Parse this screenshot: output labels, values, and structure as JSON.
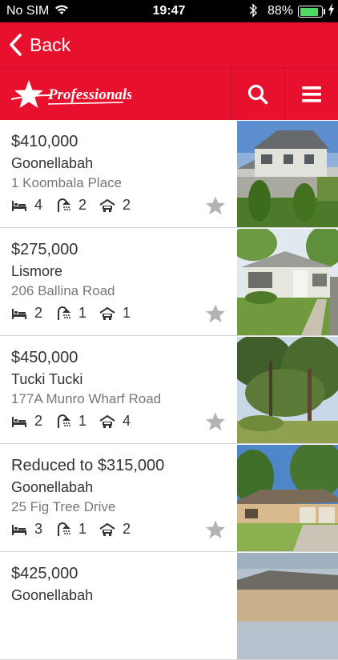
{
  "status_bar": {
    "carrier": "No SIM",
    "time": "19:47",
    "battery_percent": "88%",
    "battery_level": 0.88
  },
  "nav": {
    "back_label": "Back"
  },
  "brand": {
    "logo_text": "Professionals",
    "accent_color": "#e8112d"
  },
  "listings": [
    {
      "price": "$410,000",
      "suburb": "Goonellabah",
      "address": "1 Koombala Place",
      "beds": "4",
      "baths": "2",
      "cars": "2"
    },
    {
      "price": "$275,000",
      "suburb": "Lismore",
      "address": "206 Ballina Road",
      "beds": "2",
      "baths": "1",
      "cars": "1"
    },
    {
      "price": "$450,000",
      "suburb": "Tucki Tucki",
      "address": "177A Munro Wharf Road",
      "beds": "2",
      "baths": "1",
      "cars": "4"
    },
    {
      "price": "Reduced to $315,000",
      "suburb": "Goonellabah",
      "address": "25 Fig Tree Drive",
      "beds": "3",
      "baths": "1",
      "cars": "2"
    },
    {
      "price": "$425,000",
      "suburb": "Goonellabah",
      "address": "",
      "beds": "",
      "baths": "",
      "cars": ""
    }
  ]
}
